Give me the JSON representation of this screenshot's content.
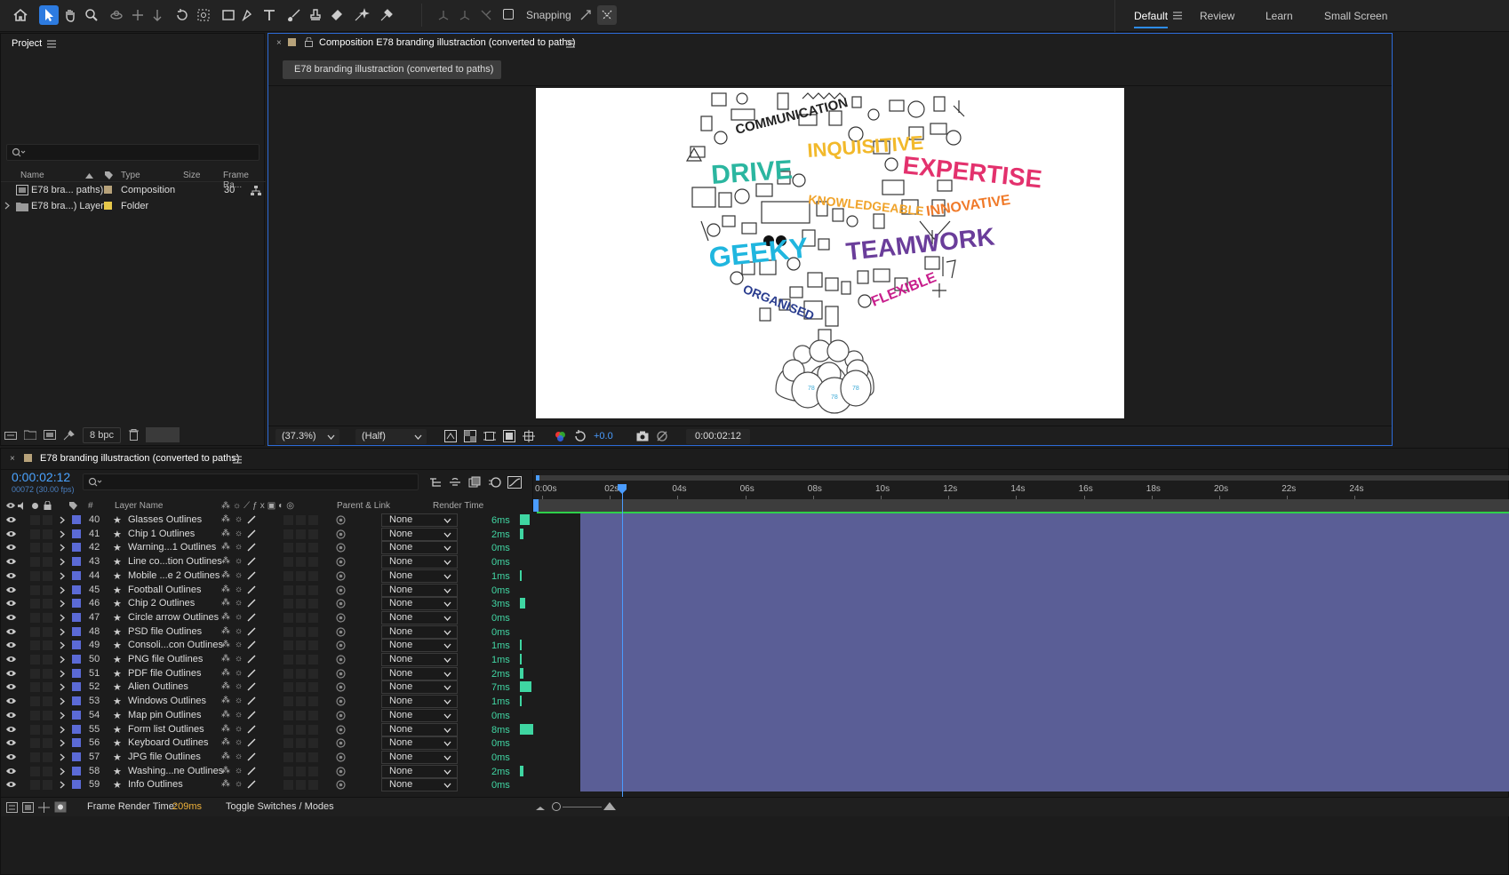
{
  "toolbar": {
    "snapping_label": "Snapping",
    "workspaces": [
      "Default",
      "Review",
      "Learn",
      "Small Screen"
    ],
    "active_workspace": "Default"
  },
  "project": {
    "title": "Project",
    "search_placeholder": "",
    "columns": {
      "name": "Name",
      "type": "Type",
      "size": "Size",
      "frame_rate": "Frame Ra..."
    },
    "items": [
      {
        "name": "E78 bra... paths)",
        "type": "Composition",
        "size": "",
        "frame_rate": "30",
        "label_color": "#b7a27a"
      },
      {
        "name": "E78 bra...) Layers",
        "type": "Folder",
        "size": "",
        "frame_rate": "",
        "label_color": "#e6c84a"
      }
    ],
    "bpc": "8 bpc"
  },
  "composition": {
    "tab_title": "Composition E78 branding illustraction (converted to paths)",
    "breadcrumb": "E78 branding illustraction (converted to paths)",
    "zoom": "(37.3%)",
    "resolution": "(Half)",
    "exposure": "+0.0",
    "timecode": "0:00:02:12",
    "artwork_words": [
      "DRIVE",
      "INQUISITIVE",
      "EXPERTISE",
      "COMMUNICATION",
      "KNOWLEDGEABLE",
      "INNOVATIVE",
      "GEEKY",
      "TEAMWORK",
      "ORGANISED",
      "FLEXIBLE"
    ]
  },
  "timeline": {
    "tab_title": "E78 branding illustraction (converted to paths)",
    "timecode": "0:00:02:12",
    "frame_info": "00072 (30.00 fps)",
    "columns": {
      "num": "#",
      "layer_name": "Layer Name",
      "parent": "Parent & Link",
      "render_time": "Render Time"
    },
    "ruler_labels": [
      "0:00s",
      "02s",
      "04s",
      "06s",
      "08s",
      "10s",
      "12s",
      "14s",
      "16s",
      "18s",
      "20s",
      "22s",
      "24s"
    ],
    "playhead_seconds": 2.4,
    "layers": [
      {
        "num": "40",
        "name": "Glasses Outlines",
        "parent": "None",
        "render": "6ms",
        "ms": 6
      },
      {
        "num": "41",
        "name": "Chip 1 Outlines",
        "parent": "None",
        "render": "2ms",
        "ms": 2
      },
      {
        "num": "42",
        "name": "Warning...1 Outlines",
        "parent": "None",
        "render": "0ms",
        "ms": 0
      },
      {
        "num": "43",
        "name": "Line co...tion Outlines",
        "parent": "None",
        "render": "0ms",
        "ms": 0
      },
      {
        "num": "44",
        "name": "Mobile ...e 2 Outlines",
        "parent": "None",
        "render": "1ms",
        "ms": 1
      },
      {
        "num": "45",
        "name": "Football Outlines",
        "parent": "None",
        "render": "0ms",
        "ms": 0
      },
      {
        "num": "46",
        "name": "Chip 2 Outlines",
        "parent": "None",
        "render": "3ms",
        "ms": 3
      },
      {
        "num": "47",
        "name": "Circle arrow Outlines",
        "parent": "None",
        "render": "0ms",
        "ms": 0
      },
      {
        "num": "48",
        "name": "PSD file Outlines",
        "parent": "None",
        "render": "0ms",
        "ms": 0
      },
      {
        "num": "49",
        "name": "Consoli...con Outlines",
        "parent": "None",
        "render": "1ms",
        "ms": 1
      },
      {
        "num": "50",
        "name": "PNG file Outlines",
        "parent": "None",
        "render": "1ms",
        "ms": 1
      },
      {
        "num": "51",
        "name": "PDF file Outlines",
        "parent": "None",
        "render": "2ms",
        "ms": 2
      },
      {
        "num": "52",
        "name": "Alien Outlines",
        "parent": "None",
        "render": "7ms",
        "ms": 7
      },
      {
        "num": "53",
        "name": "Windows Outlines",
        "parent": "None",
        "render": "1ms",
        "ms": 1
      },
      {
        "num": "54",
        "name": "Map pin Outlines",
        "parent": "None",
        "render": "0ms",
        "ms": 0
      },
      {
        "num": "55",
        "name": "Form list Outlines",
        "parent": "None",
        "render": "8ms",
        "ms": 8
      },
      {
        "num": "56",
        "name": "Keyboard Outlines",
        "parent": "None",
        "render": "0ms",
        "ms": 0
      },
      {
        "num": "57",
        "name": "JPG file Outlines",
        "parent": "None",
        "render": "0ms",
        "ms": 0
      },
      {
        "num": "58",
        "name": "Washing...ne Outlines",
        "parent": "None",
        "render": "2ms",
        "ms": 2
      },
      {
        "num": "59",
        "name": "Info Outlines",
        "parent": "None",
        "render": "0ms",
        "ms": 0
      }
    ],
    "footer": {
      "frame_render_label": "Frame Render Time:",
      "frame_render_value": "209ms",
      "toggle_label": "Toggle Switches / Modes"
    }
  }
}
